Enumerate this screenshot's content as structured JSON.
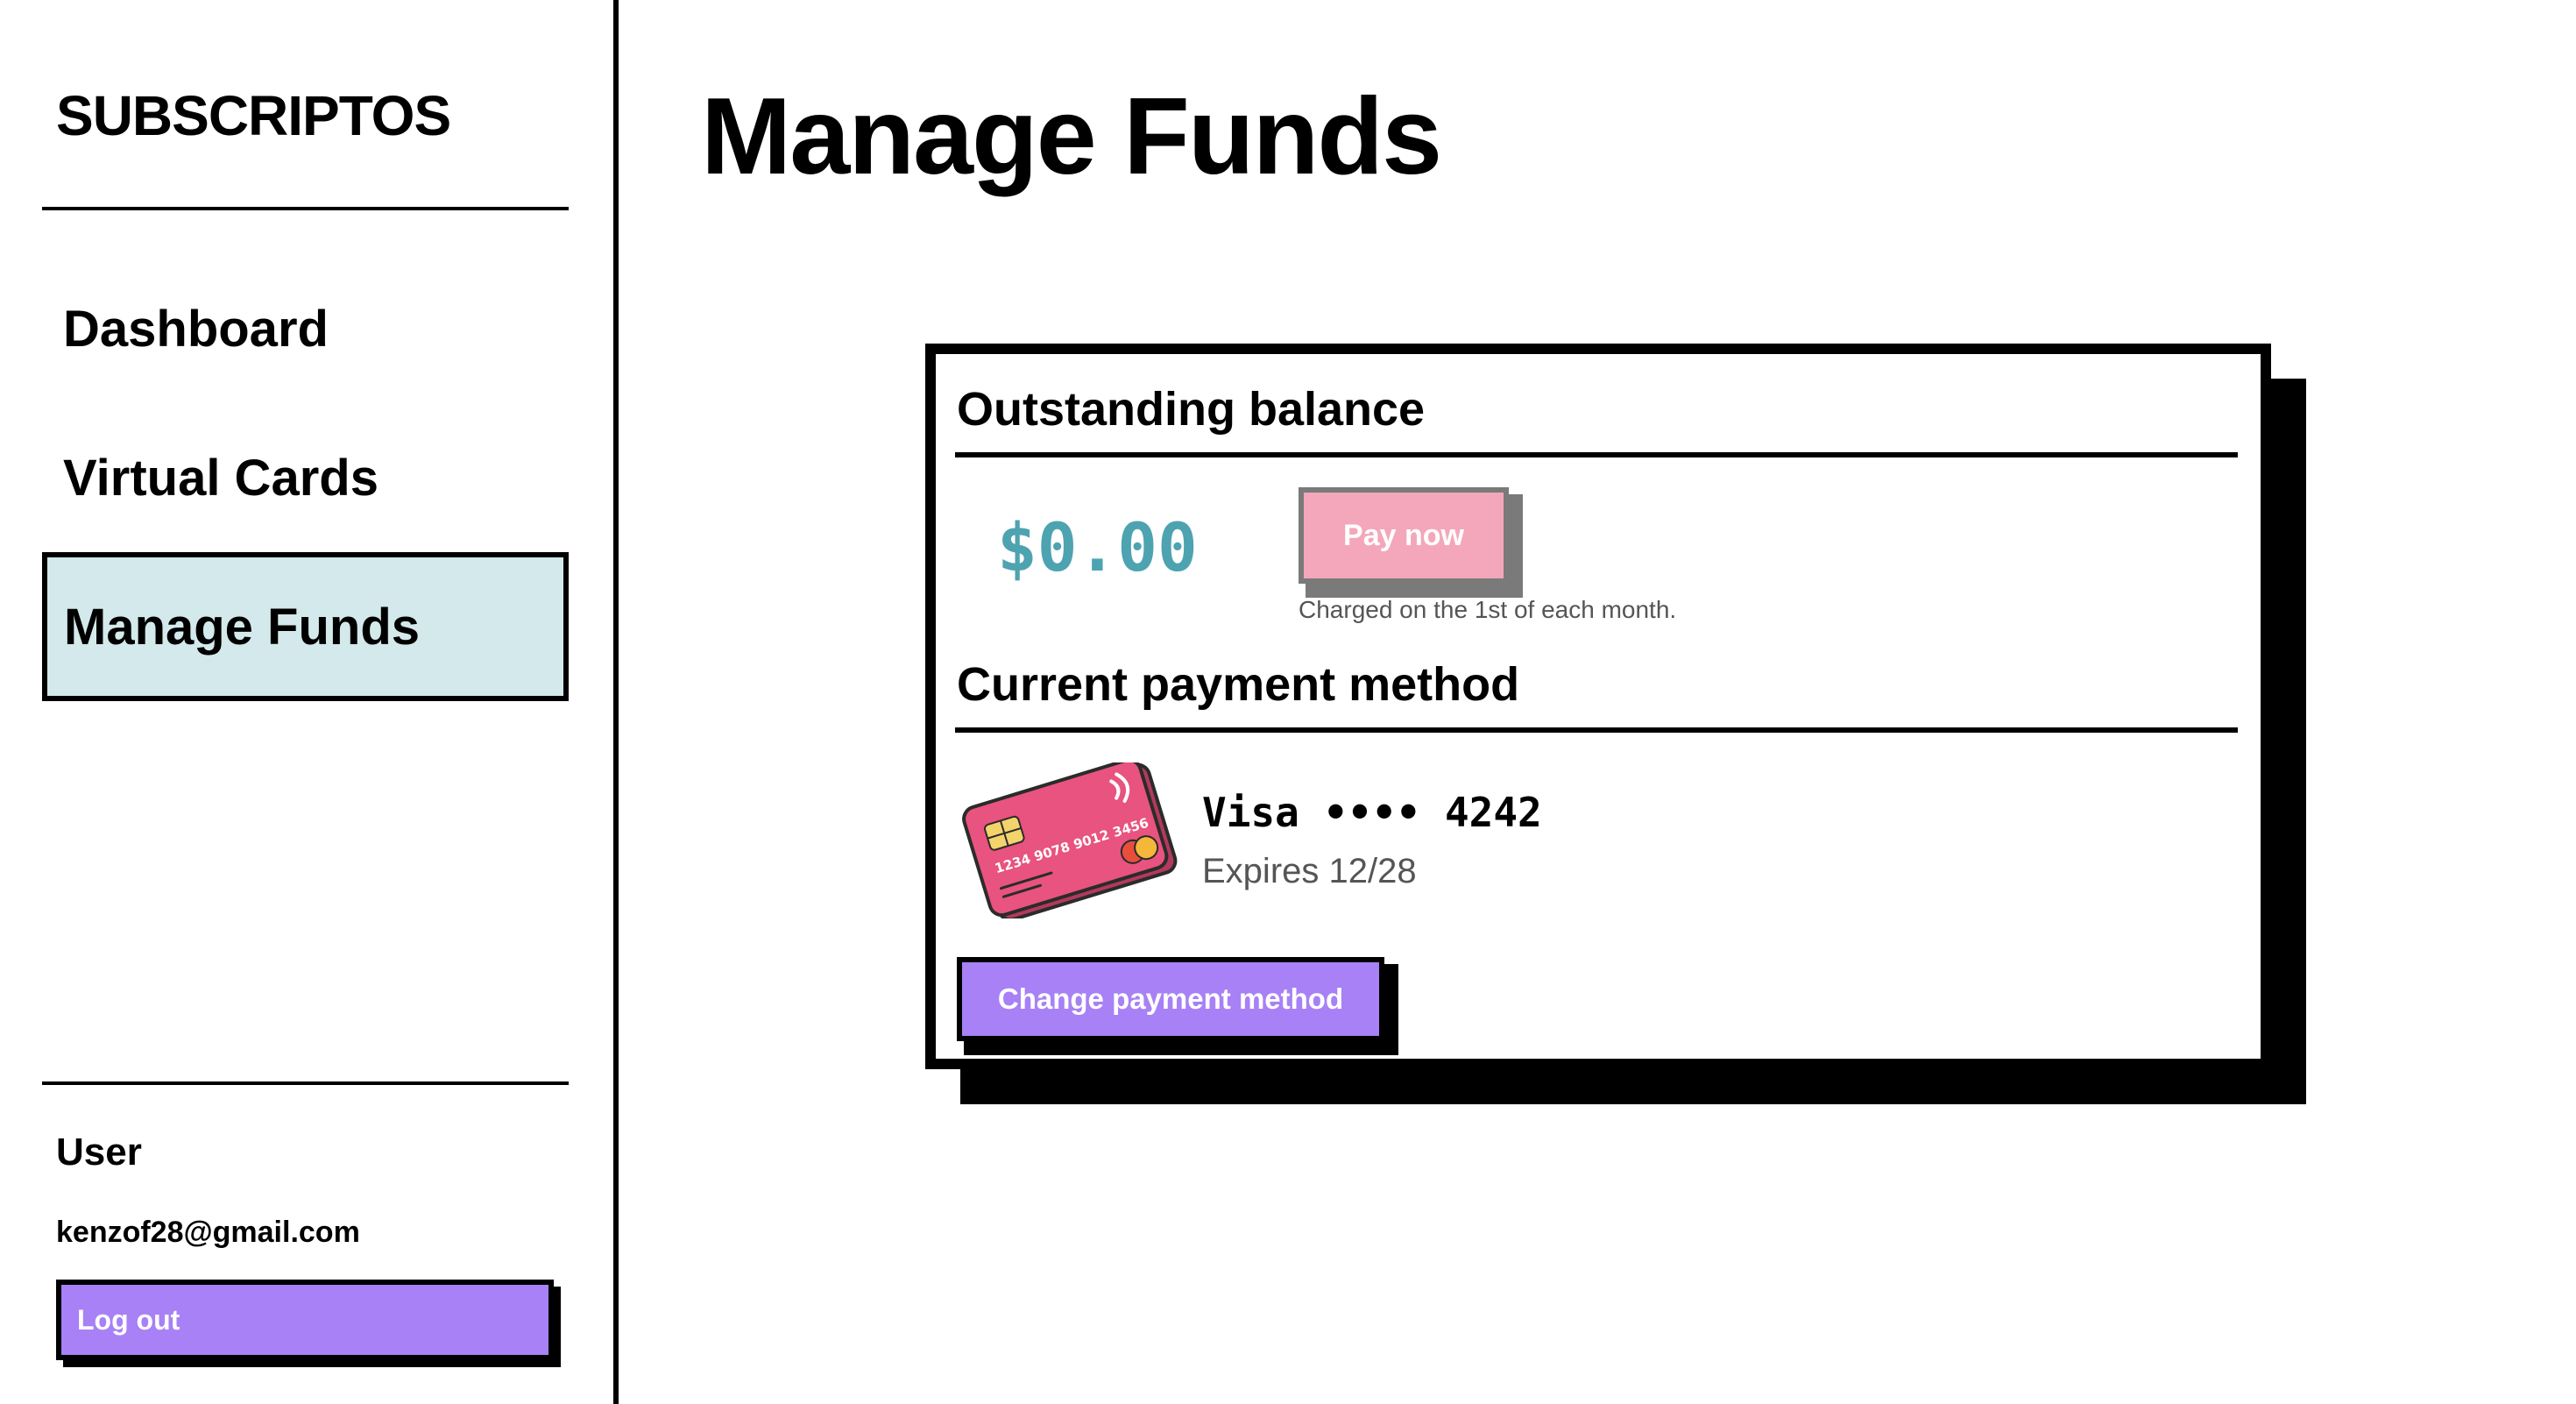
{
  "sidebar": {
    "brand": "SUBSCRIPTOS",
    "nav": [
      {
        "label": "Dashboard"
      },
      {
        "label": "Virtual Cards"
      },
      {
        "label": "Manage Funds",
        "active": true
      }
    ],
    "user": {
      "label": "User",
      "email": "kenzof28@gmail.com",
      "logout_label": "Log out"
    }
  },
  "main": {
    "title": "Manage Funds",
    "balance_section": {
      "title": "Outstanding balance",
      "amount": "$0.00",
      "pay_label": "Pay now",
      "note": "Charged on the 1st of each month."
    },
    "payment_section": {
      "title": "Current payment method",
      "card_brand_line": "Visa •••• 4242",
      "expiry": "Expires 12/28",
      "card_art_number": "1234 9078 9012 3456",
      "change_label": "Change payment method"
    }
  },
  "colors": {
    "accent_purple": "#a781f5",
    "active_nav_bg": "#d3e9eb",
    "balance_teal": "#4ea3b0",
    "pay_pink": "#f4a7bb",
    "card_pink": "#e8537f"
  },
  "icons": [
    "credit-card-illustration"
  ]
}
